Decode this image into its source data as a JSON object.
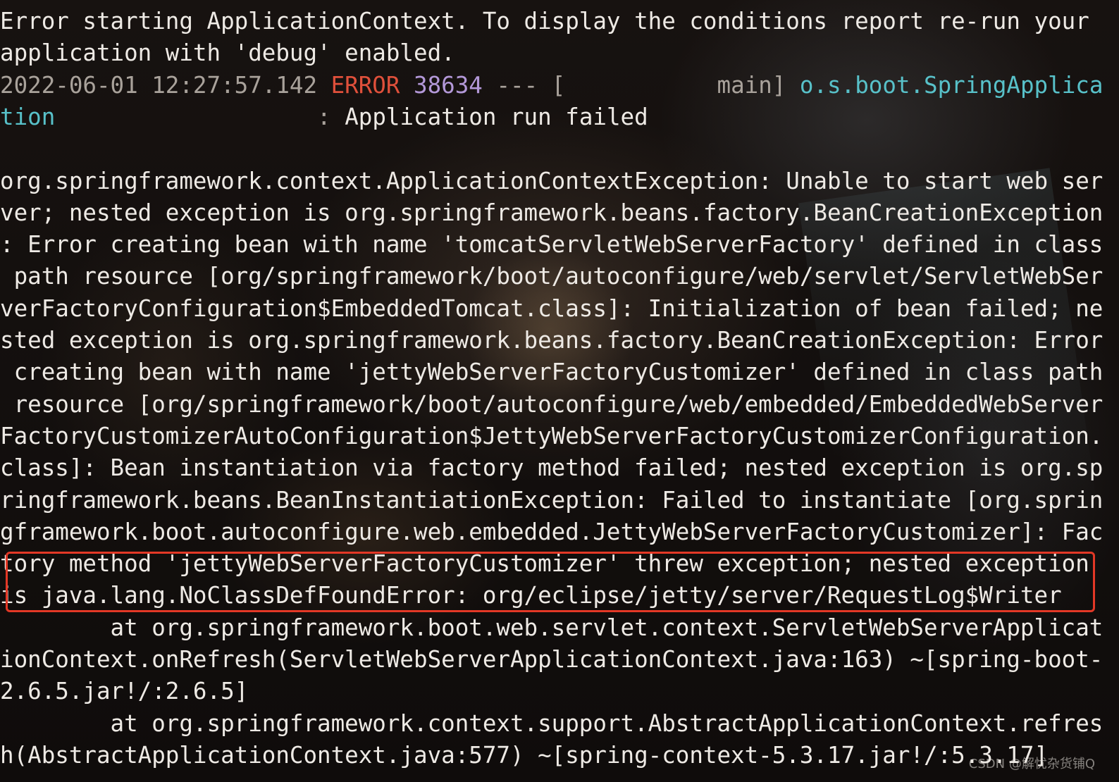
{
  "terminal": {
    "lines": [
      {
        "segments": [
          {
            "text": "Error starting ApplicationContext. To display the conditions report re-run your"
          }
        ]
      },
      {
        "segments": [
          {
            "text": "application with 'debug' enabled."
          }
        ]
      },
      {
        "segments": [
          {
            "text": "2022-06-01 12:27:57.142 "
          },
          {
            "text": "ERROR"
          },
          {
            "text": " "
          },
          {
            "text": "38634"
          },
          {
            "text": " --- [           main] "
          },
          {
            "text": "o.s.boot.SpringApplica"
          }
        ]
      },
      {
        "segments": [
          {
            "text": "tion"
          },
          {
            "text": "                   : "
          },
          {
            "text": "Application run failed"
          }
        ]
      },
      {
        "segments": [
          {
            "text": ""
          }
        ]
      },
      {
        "segments": [
          {
            "text": "org.springframework.context.ApplicationContextException: Unable to start web ser"
          }
        ]
      },
      {
        "segments": [
          {
            "text": "ver; nested exception is org.springframework.beans.factory.BeanCreationException"
          }
        ]
      },
      {
        "segments": [
          {
            "text": ": Error creating bean with name 'tomcatServletWebServerFactory' defined in class"
          }
        ]
      },
      {
        "segments": [
          {
            "text": " path resource [org/springframework/boot/autoconfigure/web/servlet/ServletWebSer"
          }
        ]
      },
      {
        "segments": [
          {
            "text": "verFactoryConfiguration$EmbeddedTomcat.class]: Initialization of bean failed; ne"
          }
        ]
      },
      {
        "segments": [
          {
            "text": "sted exception is org.springframework.beans.factory.BeanCreationException: Error"
          }
        ]
      },
      {
        "segments": [
          {
            "text": " creating bean with name 'jettyWebServerFactoryCustomizer' defined in class path"
          }
        ]
      },
      {
        "segments": [
          {
            "text": " resource [org/springframework/boot/autoconfigure/web/embedded/EmbeddedWebServer"
          }
        ]
      },
      {
        "segments": [
          {
            "text": "FactoryCustomizerAutoConfiguration$JettyWebServerFactoryCustomizerConfiguration."
          }
        ]
      },
      {
        "segments": [
          {
            "text": "class]: Bean instantiation via factory method failed; nested exception is org.sp"
          }
        ]
      },
      {
        "segments": [
          {
            "text": "ringframework.beans.BeanInstantiationException: Failed to instantiate [org.sprin"
          }
        ]
      },
      {
        "segments": [
          {
            "text": "gframework.boot.autoconfigure.web.embedded.JettyWebServerFactoryCustomizer]: Fac"
          }
        ]
      },
      {
        "segments": [
          {
            "text": "tory method 'jettyWebServerFactoryCustomizer' threw exception; nested exception"
          }
        ]
      },
      {
        "segments": [
          {
            "text": "is java.lang.NoClassDefFoundError: org/eclipse/jetty/server/RequestLog$Writer"
          }
        ]
      },
      {
        "segments": [
          {
            "text": "        at org.springframework.boot.web.servlet.context.ServletWebServerApplicat"
          }
        ]
      },
      {
        "segments": [
          {
            "text": "ionContext.onRefresh(ServletWebServerApplicationContext.java:163) ~[spring-boot-"
          }
        ]
      },
      {
        "segments": [
          {
            "text": "2.6.5.jar!/:2.6.5]"
          }
        ]
      },
      {
        "segments": [
          {
            "text": "        at org.springframework.context.support.AbstractApplicationContext.refres"
          }
        ]
      },
      {
        "segments": [
          {
            "text": "h(AbstractApplicationContext.java:577) ~[spring-context-5.3.17.jar!/:5.3.17]"
          }
        ]
      }
    ]
  },
  "watermark": "CSDN @解忧杂货铺Q",
  "colors": {
    "error": "#e0503b",
    "pid": "#b398d8",
    "logger": "#58c1c9",
    "highlight_box": "#e33826"
  }
}
